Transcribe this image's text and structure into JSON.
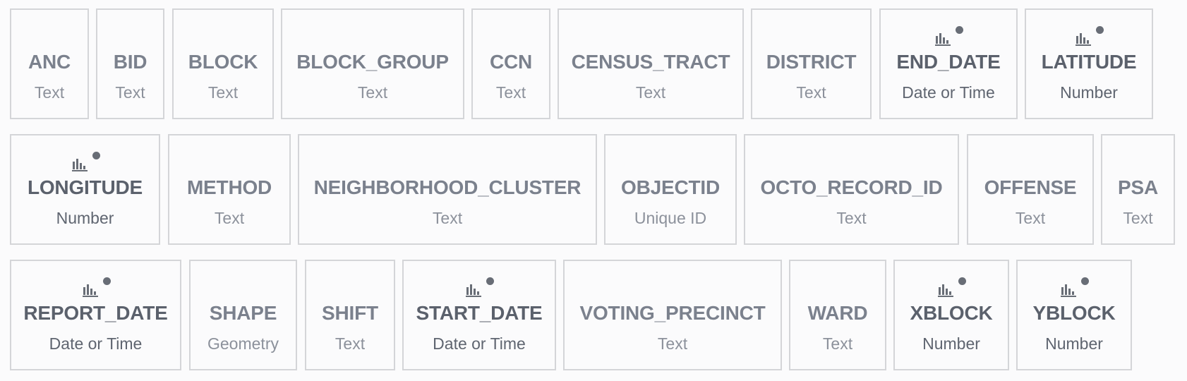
{
  "columns": [
    {
      "name": "ANC",
      "type": "Text",
      "analyzed": false
    },
    {
      "name": "BID",
      "type": "Text",
      "analyzed": false
    },
    {
      "name": "BLOCK",
      "type": "Text",
      "analyzed": false
    },
    {
      "name": "BLOCK_GROUP",
      "type": "Text",
      "analyzed": false
    },
    {
      "name": "CCN",
      "type": "Text",
      "analyzed": false
    },
    {
      "name": "CENSUS_TRACT",
      "type": "Text",
      "analyzed": false
    },
    {
      "name": "DISTRICT",
      "type": "Text",
      "analyzed": false
    },
    {
      "name": "END_DATE",
      "type": "Date or Time",
      "analyzed": true
    },
    {
      "name": "LATITUDE",
      "type": "Number",
      "analyzed": true
    },
    {
      "name": "LONGITUDE",
      "type": "Number",
      "analyzed": true
    },
    {
      "name": "METHOD",
      "type": "Text",
      "analyzed": false
    },
    {
      "name": "NEIGHBORHOOD_CLUSTER",
      "type": "Text",
      "analyzed": false
    },
    {
      "name": "OBJECTID",
      "type": "Unique ID",
      "analyzed": false
    },
    {
      "name": "OCTO_RECORD_ID",
      "type": "Text",
      "analyzed": false
    },
    {
      "name": "OFFENSE",
      "type": "Text",
      "analyzed": false
    },
    {
      "name": "PSA",
      "type": "Text",
      "analyzed": false
    },
    {
      "name": "REPORT_DATE",
      "type": "Date or Time",
      "analyzed": true
    },
    {
      "name": "SHAPE",
      "type": "Geometry",
      "analyzed": false
    },
    {
      "name": "SHIFT",
      "type": "Text",
      "analyzed": false
    },
    {
      "name": "START_DATE",
      "type": "Date or Time",
      "analyzed": true
    },
    {
      "name": "VOTING_PRECINCT",
      "type": "Text",
      "analyzed": false
    },
    {
      "name": "WARD",
      "type": "Text",
      "analyzed": false
    },
    {
      "name": "XBLOCK",
      "type": "Number",
      "analyzed": true
    },
    {
      "name": "YBLOCK",
      "type": "Number",
      "analyzed": true
    }
  ],
  "colors": {
    "analyzed_text": "#5b616c",
    "plain_text": "#7b818d",
    "border": "#d4d5d8",
    "dot": "#686d76"
  },
  "icons": {
    "stat": "bar-chart-icon",
    "indicator": "dot-icon"
  }
}
